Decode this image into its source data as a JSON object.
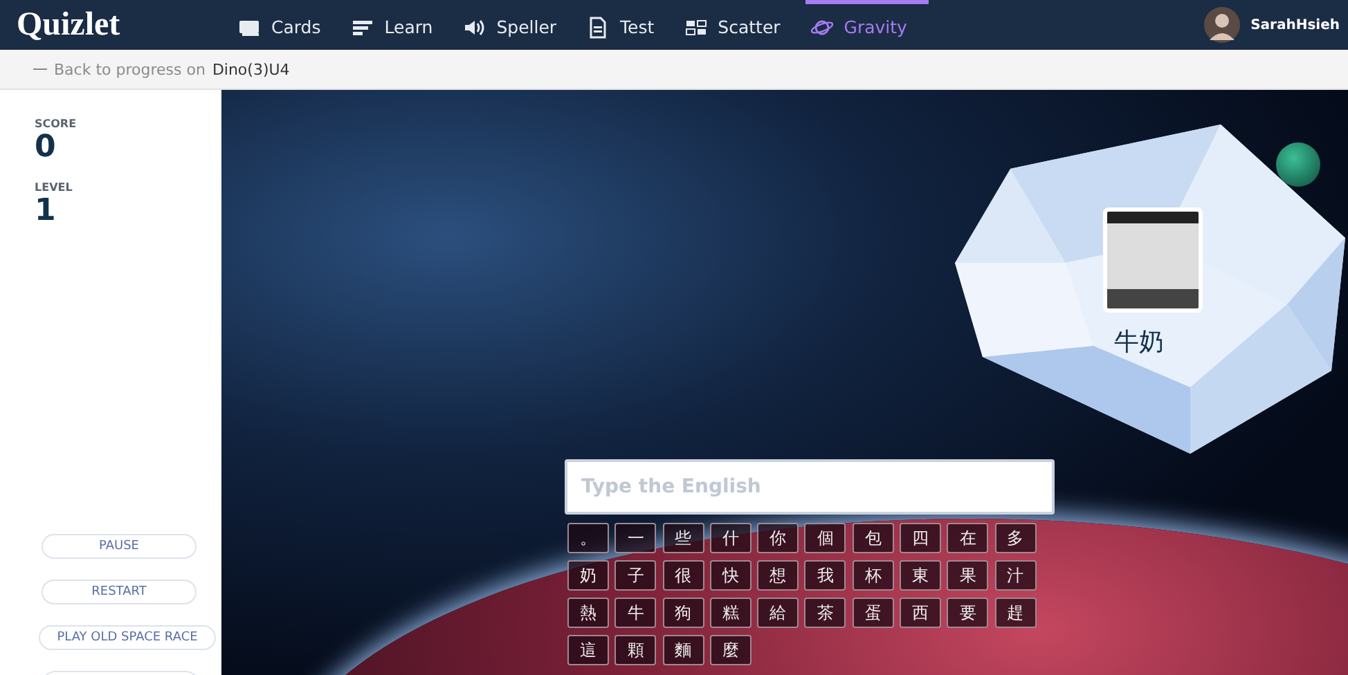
{
  "header": {
    "logo": "Quizlet",
    "tabs": [
      {
        "label": "Cards",
        "kind": "cards",
        "selected": false
      },
      {
        "label": "Learn",
        "kind": "learn",
        "selected": false
      },
      {
        "label": "Speller",
        "kind": "speller",
        "selected": false
      },
      {
        "label": "Test",
        "kind": "test",
        "selected": false
      },
      {
        "label": "Scatter",
        "kind": "scatter",
        "selected": false
      },
      {
        "label": "Gravity",
        "kind": "gravity",
        "selected": true
      }
    ],
    "user": {
      "name": "SarahHsieh"
    }
  },
  "back_link": {
    "text": "Back to progress on",
    "set_name": "Dino(3)U4"
  },
  "sidebar": {
    "stats": [
      {
        "label": "SCORE",
        "value": "0"
      },
      {
        "label": "LEVEL",
        "value": "1"
      }
    ],
    "buttons": [
      "PAUSE",
      "RESTART",
      "PLAY OLD SPACE RACE"
    ]
  },
  "game": {
    "asteroid": {
      "term": "牛奶"
    },
    "answer": {
      "placeholder": "Type the English"
    },
    "keys": [
      "。",
      "一",
      "些",
      "什",
      "你",
      "個",
      "包",
      "四",
      "在",
      "多",
      "奶",
      "子",
      "很",
      "快",
      "想",
      "我",
      "杯",
      "東",
      "果",
      "汁",
      "熱",
      "牛",
      "狗",
      "糕",
      "給",
      "茶",
      "蛋",
      "西",
      "要",
      "趕",
      "這",
      "顆",
      "麵",
      "麼"
    ]
  }
}
